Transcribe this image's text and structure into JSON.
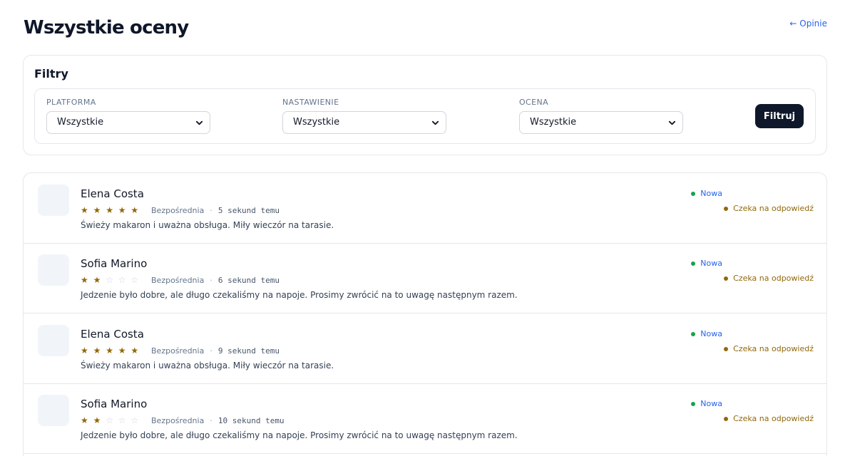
{
  "header": {
    "title": "Wszystkie oceny",
    "back_link": "← Opinie"
  },
  "filters": {
    "title": "Filtry",
    "platform": {
      "label": "PLATFORMA",
      "value": "Wszystkie"
    },
    "sentiment": {
      "label": "NASTAWIENIE",
      "value": "Wszystkie"
    },
    "rating": {
      "label": "OCENA",
      "value": "Wszystkie"
    },
    "submit_label": "Filtruj"
  },
  "colors": {
    "accent_dark": "#0f172a",
    "link_blue": "#2563eb",
    "star_gold": "#92680a",
    "new_dot_green": "#16a34a"
  },
  "reviews": [
    {
      "name": "Elena Costa",
      "rating": 5,
      "source": "Bezpośrednia",
      "time": "5 sekund temu",
      "text": "Świeży makaron i uważna obsługa. Miły wieczór na tarasie.",
      "status_new": "Nowa",
      "status_reply": "Czeka na odpowiedź"
    },
    {
      "name": "Sofia Marino",
      "rating": 2,
      "source": "Bezpośrednia",
      "time": "6 sekund temu",
      "text": "Jedzenie było dobre, ale długo czekaliśmy na napoje. Prosimy zwrócić na to uwagę następnym razem.",
      "status_new": "Nowa",
      "status_reply": "Czeka na odpowiedź"
    },
    {
      "name": "Elena Costa",
      "rating": 5,
      "source": "Bezpośrednia",
      "time": "9 sekund temu",
      "text": "Świeży makaron i uważna obsługa. Miły wieczór na tarasie.",
      "status_new": "Nowa",
      "status_reply": "Czeka na odpowiedź"
    },
    {
      "name": "Sofia Marino",
      "rating": 2,
      "source": "Bezpośrednia",
      "time": "10 sekund temu",
      "text": "Jedzenie było dobre, ale długo czekaliśmy na napoje. Prosimy zwrócić na to uwagę następnym razem.",
      "status_new": "Nowa",
      "status_reply": "Czeka na odpowiedź"
    }
  ]
}
